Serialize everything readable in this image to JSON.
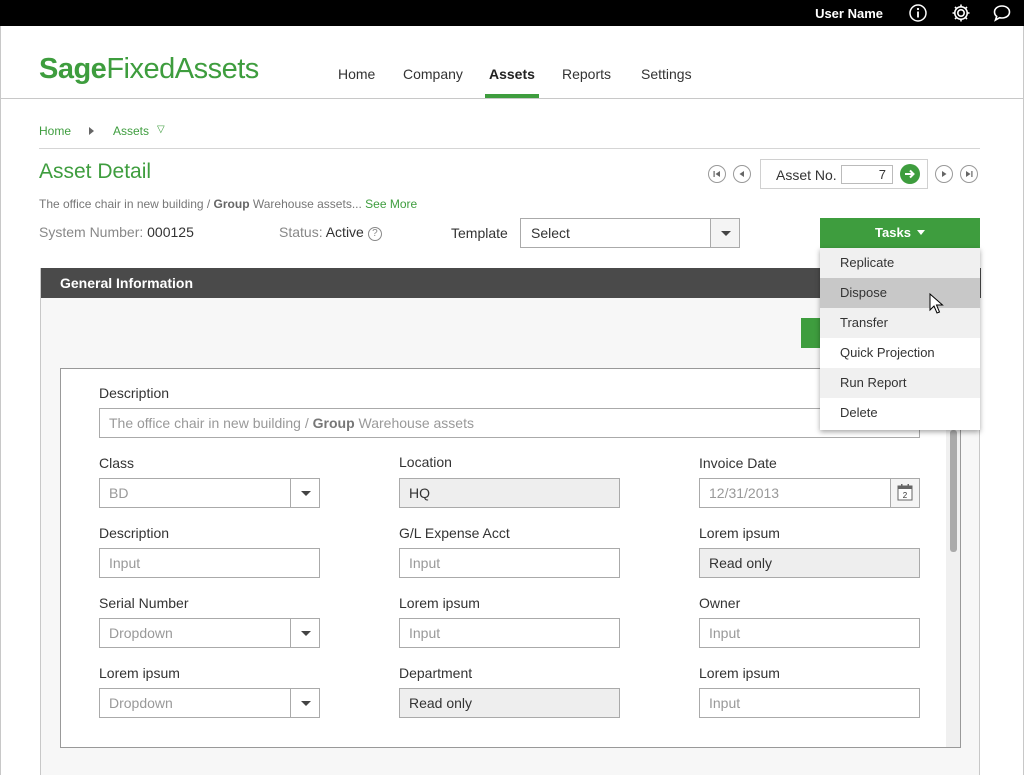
{
  "topbar": {
    "username": "User Name",
    "icons": [
      "info-icon",
      "gear-icon",
      "chat-icon"
    ]
  },
  "brand": {
    "part1": "Sage",
    "part2": "FixedAssets"
  },
  "nav": {
    "home": "Home",
    "company": "Company",
    "assets": "Assets",
    "reports": "Reports",
    "settings": "Settings",
    "active": "Assets"
  },
  "breadcrumb": {
    "home": "Home",
    "assets": "Assets",
    "caret": "▽"
  },
  "page": {
    "title": "Asset Detail",
    "subtitle_pre": "The office chair in new building / ",
    "subtitle_bold": "Group",
    "subtitle_post": " Warehouse assets...",
    "see_more": "See More"
  },
  "asset_nav": {
    "label": "Asset No.",
    "value": "7"
  },
  "system": {
    "sys_label": "System Number:",
    "sys_value": "000125",
    "status_label": "Status:",
    "status_value": "Active",
    "help": "?"
  },
  "template": {
    "label": "Template",
    "value": "Select"
  },
  "tasks": {
    "label": "Tasks",
    "items": [
      "Replicate",
      "Dispose",
      "Transfer",
      "Quick Projection",
      "Run Report",
      "Delete"
    ],
    "hovered": "Dispose"
  },
  "panel": {
    "title": "General Information"
  },
  "form": {
    "description": {
      "label": "Description",
      "value_pre": "The office chair in new building / ",
      "value_bold": "Group",
      "value_post": " Warehouse assets"
    },
    "class": {
      "label": "Class",
      "value": "BD"
    },
    "location": {
      "label": "Location",
      "value": "HQ"
    },
    "invoice_date": {
      "label": "Invoice Date",
      "value": "12/31/2013",
      "cal_day": "2"
    },
    "description2": {
      "label": "Description",
      "placeholder": "Input"
    },
    "gl_expense": {
      "label": "G/L Expense Acct",
      "placeholder": "Input"
    },
    "lorem1": {
      "label": "Lorem ipsum",
      "value": "Read only"
    },
    "serial": {
      "label": "Serial Number",
      "placeholder": "Dropdown"
    },
    "lorem2": {
      "label": "Lorem ipsum",
      "placeholder": "Input"
    },
    "owner": {
      "label": "Owner",
      "placeholder": "Input"
    },
    "lorem3": {
      "label": "Lorem ipsum",
      "placeholder": "Dropdown"
    },
    "department": {
      "label": "Department",
      "value": "Read only"
    },
    "lorem4": {
      "label": "Lorem ipsum",
      "placeholder": "Input"
    }
  },
  "colors": {
    "brand": "#3e9d3e",
    "header": "#4a4a4a",
    "topbar": "#000000"
  }
}
